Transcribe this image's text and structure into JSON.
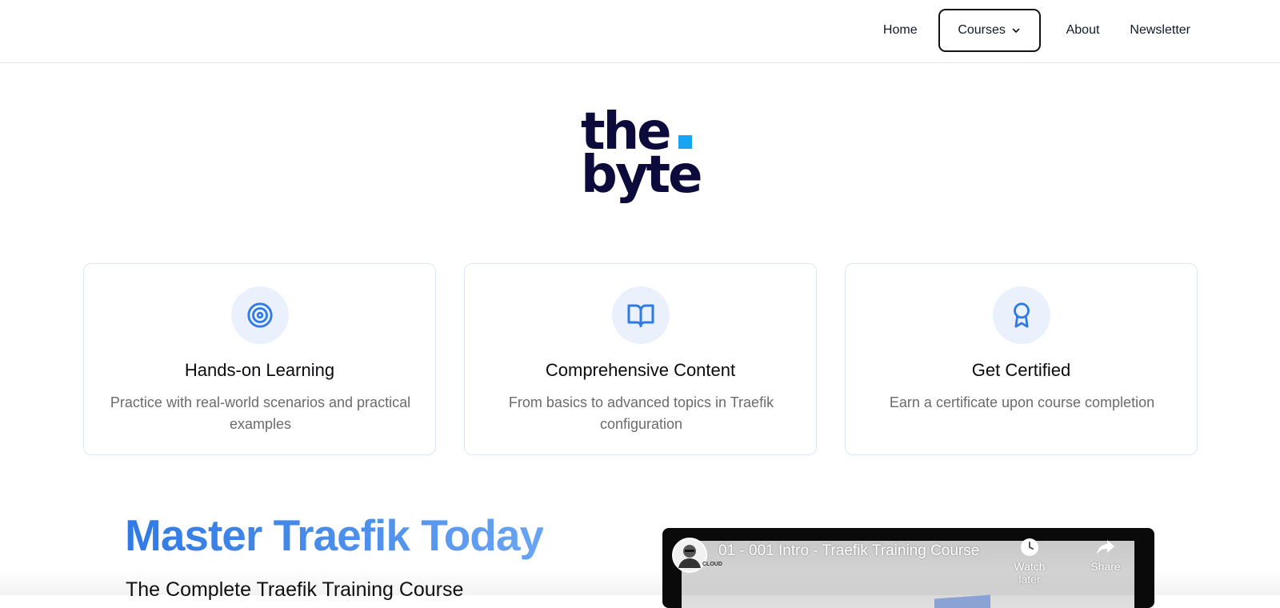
{
  "nav": {
    "items": [
      {
        "label": "Home"
      },
      {
        "label": "Courses"
      },
      {
        "label": "About"
      },
      {
        "label": "Newsletter"
      }
    ]
  },
  "logo": {
    "line1": "the",
    "line2": "byte",
    "text_color": "#0c0b3b",
    "dot_color": "#19a3f0"
  },
  "features": [
    {
      "icon": "target-icon",
      "title": "Hands-on Learning",
      "description": "Practice with real-world scenarios and practical examples"
    },
    {
      "icon": "book-open-icon",
      "title": "Comprehensive Content",
      "description": "From basics to advanced topics in Traefik configuration"
    },
    {
      "icon": "award-icon",
      "title": "Get Certified",
      "description": "Earn a certificate upon course completion"
    }
  ],
  "hero": {
    "title": "Master Traefik Today",
    "subtitle": "The Complete Traefik Training Course"
  },
  "video": {
    "title": "01 - 001 Intro - Traefik Training Course",
    "channel_badge": "CLOUD",
    "watch_later_label": "Watch later",
    "share_label": "Share"
  },
  "colors": {
    "accent": "#2f7ae5",
    "icon_bg": "#eaf1fd",
    "card_border": "#dbe7f6"
  }
}
